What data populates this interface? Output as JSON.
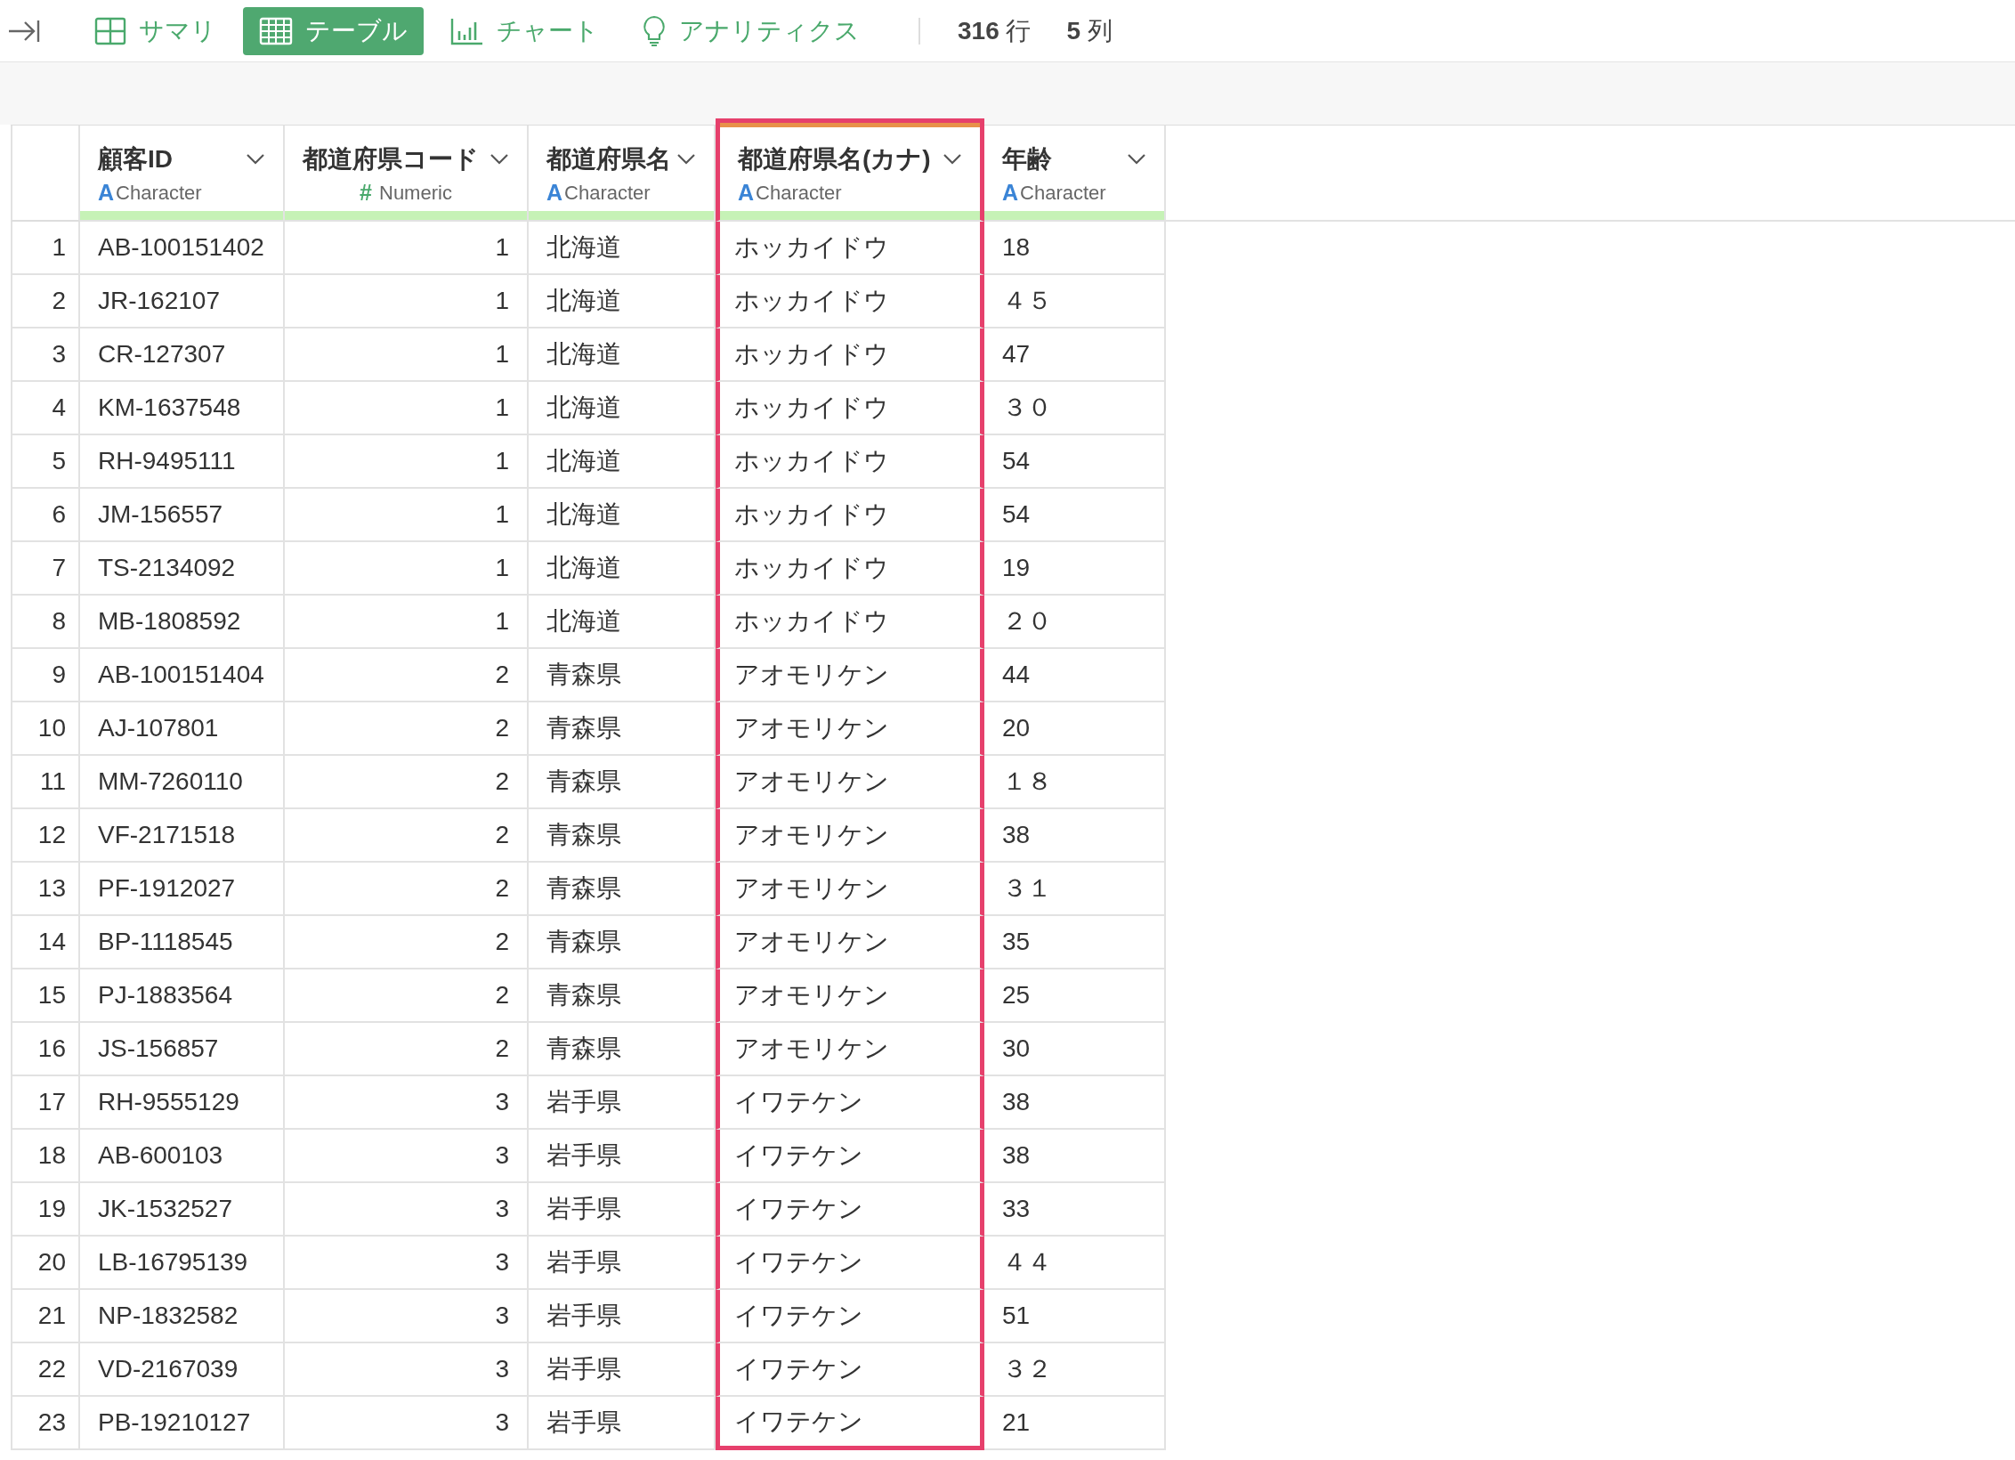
{
  "toolbar": {
    "tabs": [
      {
        "label": "サマリ",
        "kind": "grid",
        "selected": false
      },
      {
        "label": "テーブル",
        "kind": "table",
        "selected": true
      },
      {
        "label": "チャート",
        "kind": "chart",
        "selected": false
      },
      {
        "label": "アナリティクス",
        "kind": "bulb",
        "selected": false
      }
    ],
    "stats": [
      "**316** 行",
      "**5** 列"
    ]
  },
  "table": {
    "columns": [
      {
        "name": "顧客ID",
        "type_icon": "A",
        "type": "Character",
        "kind": "character",
        "selected": false
      },
      {
        "name": "都道府県コード",
        "type_icon": "#",
        "type": "Numeric",
        "kind": "numeric",
        "selected": false
      },
      {
        "name": "都道府県名",
        "type_icon": "A",
        "type": "Character",
        "kind": "character",
        "selected": false
      },
      {
        "name": "都道府県名(カナ)",
        "type_icon": "A",
        "type": "Character",
        "kind": "character",
        "selected": true
      },
      {
        "name": "年齢",
        "type_icon": "A",
        "type": "Character",
        "kind": "character",
        "selected": false
      }
    ],
    "rows": [
      {
        "index": "1",
        "cells": [
          "AB-100151402",
          "1",
          "北海道",
          "ホッカイドウ",
          "18"
        ]
      },
      {
        "index": "2",
        "cells": [
          "JR-162107",
          "1",
          "北海道",
          "ホッカイドウ",
          "４５"
        ]
      },
      {
        "index": "3",
        "cells": [
          "CR-127307",
          "1",
          "北海道",
          "ホッカイドウ",
          "47"
        ]
      },
      {
        "index": "4",
        "cells": [
          "KM-1637548",
          "1",
          "北海道",
          "ホッカイドウ",
          "３０"
        ]
      },
      {
        "index": "5",
        "cells": [
          "RH-9495111",
          "1",
          "北海道",
          "ホッカイドウ",
          "54"
        ]
      },
      {
        "index": "6",
        "cells": [
          "JM-156557",
          "1",
          "北海道",
          "ホッカイドウ",
          "54"
        ]
      },
      {
        "index": "7",
        "cells": [
          "TS-2134092",
          "1",
          "北海道",
          "ホッカイドウ",
          "19"
        ]
      },
      {
        "index": "8",
        "cells": [
          "MB-1808592",
          "1",
          "北海道",
          "ホッカイドウ",
          "２０"
        ]
      },
      {
        "index": "9",
        "cells": [
          "AB-100151404",
          "2",
          "青森県",
          "アオモリケン",
          "44"
        ]
      },
      {
        "index": "10",
        "cells": [
          "AJ-107801",
          "2",
          "青森県",
          "アオモリケン",
          "20"
        ]
      },
      {
        "index": "11",
        "cells": [
          "MM-7260110",
          "2",
          "青森県",
          "アオモリケン",
          "１８"
        ]
      },
      {
        "index": "12",
        "cells": [
          "VF-2171518",
          "2",
          "青森県",
          "アオモリケン",
          "38"
        ]
      },
      {
        "index": "13",
        "cells": [
          "PF-1912027",
          "2",
          "青森県",
          "アオモリケン",
          "３１"
        ]
      },
      {
        "index": "14",
        "cells": [
          "BP-1118545",
          "2",
          "青森県",
          "アオモリケン",
          "35"
        ]
      },
      {
        "index": "15",
        "cells": [
          "PJ-1883564",
          "2",
          "青森県",
          "アオモリケン",
          "25"
        ]
      },
      {
        "index": "16",
        "cells": [
          "JS-156857",
          "2",
          "青森県",
          "アオモリケン",
          "30"
        ]
      },
      {
        "index": "17",
        "cells": [
          "RH-9555129",
          "3",
          "岩手県",
          "イワテケン",
          "38"
        ]
      },
      {
        "index": "18",
        "cells": [
          "AB-600103",
          "3",
          "岩手県",
          "イワテケン",
          "38"
        ]
      },
      {
        "index": "19",
        "cells": [
          "JK-1532527",
          "3",
          "岩手県",
          "イワテケン",
          "33"
        ]
      },
      {
        "index": "20",
        "cells": [
          "LB-16795139",
          "3",
          "岩手県",
          "イワテケン",
          "４４"
        ]
      },
      {
        "index": "21",
        "cells": [
          "NP-1832582",
          "3",
          "岩手県",
          "イワテケン",
          "51"
        ]
      },
      {
        "index": "22",
        "cells": [
          "VD-2167039",
          "3",
          "岩手県",
          "イワテケン",
          "３２"
        ]
      },
      {
        "index": "23",
        "cells": [
          "PB-19210127",
          "3",
          "岩手県",
          "イワテケン",
          "21"
        ]
      }
    ]
  }
}
